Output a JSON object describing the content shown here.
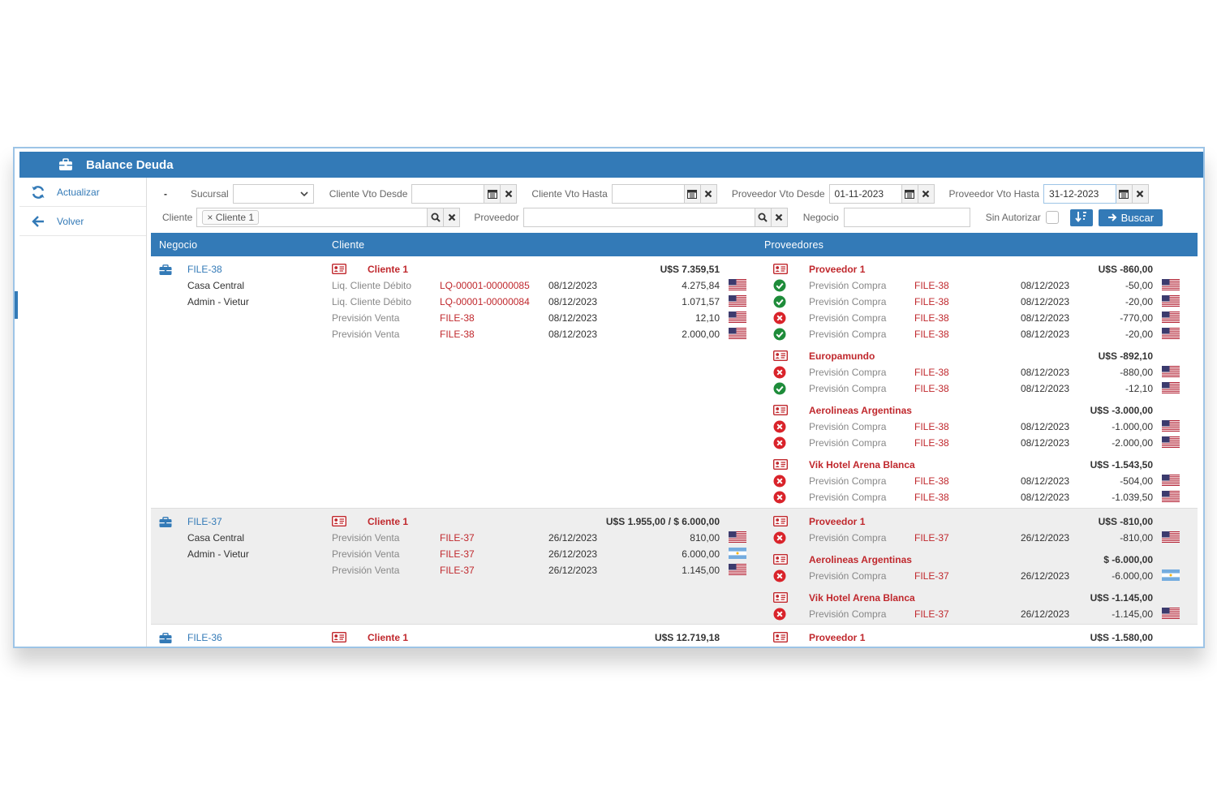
{
  "window": {
    "title": "Balance Deuda"
  },
  "sidebar": {
    "items": [
      {
        "label": "Actualizar",
        "icon": "refresh-icon"
      },
      {
        "label": "Volver",
        "icon": "arrow-left-icon"
      }
    ]
  },
  "filters": {
    "collapse": "-",
    "sucursal_label": "Sucursal",
    "cliente_vto_desde_label": "Cliente Vto Desde",
    "cliente_vto_hasta_label": "Cliente Vto Hasta",
    "proveedor_vto_desde_label": "Proveedor Vto Desde",
    "proveedor_vto_desde_value": "01-11-2023",
    "proveedor_vto_hasta_label": "Proveedor Vto Hasta",
    "proveedor_vto_hasta_value": "31-12-2023",
    "cliente_label": "Cliente",
    "cliente_tag": "× Cliente 1",
    "proveedor_label": "Proveedor",
    "negocio_label": "Negocio",
    "sin_autorizar_label": "Sin Autorizar",
    "buscar_label": "Buscar"
  },
  "table": {
    "headers": {
      "negocio": "Negocio",
      "cliente": "Cliente",
      "proveedores": "Proveedores"
    },
    "groups": [
      {
        "file": "FILE-38",
        "sucursal": "Casa Central",
        "admin": "Admin - Vietur",
        "cliente": {
          "name": "Cliente 1",
          "total": "U$S 7.359,51",
          "rows": [
            {
              "tipo": "Liq. Cliente Débito",
              "ref": "LQ-00001-00000085",
              "fecha": "08/12/2023",
              "importe": "4.275,84",
              "flag": "us"
            },
            {
              "tipo": "Liq. Cliente Débito",
              "ref": "LQ-00001-00000084",
              "fecha": "08/12/2023",
              "importe": "1.071,57",
              "flag": "us"
            },
            {
              "tipo": "Previsión Venta",
              "ref": "FILE-38",
              "fecha": "08/12/2023",
              "importe": "12,10",
              "flag": "us"
            },
            {
              "tipo": "Previsión Venta",
              "ref": "FILE-38",
              "fecha": "08/12/2023",
              "importe": "2.000,00",
              "flag": "us"
            }
          ]
        },
        "proveedores": [
          {
            "name": "Proveedor 1",
            "total": "U$S -860,00",
            "rows": [
              {
                "status": "ok",
                "tipo": "Previsión Compra",
                "ref": "FILE-38",
                "fecha": "08/12/2023",
                "importe": "-50,00",
                "flag": "us"
              },
              {
                "status": "ok",
                "tipo": "Previsión Compra",
                "ref": "FILE-38",
                "fecha": "08/12/2023",
                "importe": "-20,00",
                "flag": "us"
              },
              {
                "status": "x",
                "tipo": "Previsión Compra",
                "ref": "FILE-38",
                "fecha": "08/12/2023",
                "importe": "-770,00",
                "flag": "us"
              },
              {
                "status": "ok",
                "tipo": "Previsión Compra",
                "ref": "FILE-38",
                "fecha": "08/12/2023",
                "importe": "-20,00",
                "flag": "us"
              }
            ]
          },
          {
            "name": "Europamundo",
            "total": "U$S -892,10",
            "rows": [
              {
                "status": "x",
                "tipo": "Previsión Compra",
                "ref": "FILE-38",
                "fecha": "08/12/2023",
                "importe": "-880,00",
                "flag": "us"
              },
              {
                "status": "ok",
                "tipo": "Previsión Compra",
                "ref": "FILE-38",
                "fecha": "08/12/2023",
                "importe": "-12,10",
                "flag": "us"
              }
            ]
          },
          {
            "name": "Aerolineas Argentinas",
            "total": "U$S -3.000,00",
            "rows": [
              {
                "status": "x",
                "tipo": "Previsión Compra",
                "ref": "FILE-38",
                "fecha": "08/12/2023",
                "importe": "-1.000,00",
                "flag": "us"
              },
              {
                "status": "x",
                "tipo": "Previsión Compra",
                "ref": "FILE-38",
                "fecha": "08/12/2023",
                "importe": "-2.000,00",
                "flag": "us"
              }
            ]
          },
          {
            "name": "Vik Hotel Arena Blanca",
            "total": "U$S -1.543,50",
            "rows": [
              {
                "status": "x",
                "tipo": "Previsión Compra",
                "ref": "FILE-38",
                "fecha": "08/12/2023",
                "importe": "-504,00",
                "flag": "us"
              },
              {
                "status": "x",
                "tipo": "Previsión Compra",
                "ref": "FILE-38",
                "fecha": "08/12/2023",
                "importe": "-1.039,50",
                "flag": "us"
              }
            ]
          }
        ]
      },
      {
        "file": "FILE-37",
        "sucursal": "Casa Central",
        "admin": "Admin - Vietur",
        "cliente": {
          "name": "Cliente 1",
          "total": "U$S 1.955,00 / $ 6.000,00",
          "rows": [
            {
              "tipo": "Previsión Venta",
              "ref": "FILE-37",
              "fecha": "26/12/2023",
              "importe": "810,00",
              "flag": "us"
            },
            {
              "tipo": "Previsión Venta",
              "ref": "FILE-37",
              "fecha": "26/12/2023",
              "importe": "6.000,00",
              "flag": "ar"
            },
            {
              "tipo": "Previsión Venta",
              "ref": "FILE-37",
              "fecha": "26/12/2023",
              "importe": "1.145,00",
              "flag": "us"
            }
          ]
        },
        "proveedores": [
          {
            "name": "Proveedor 1",
            "total": "U$S -810,00",
            "rows": [
              {
                "status": "x",
                "tipo": "Previsión Compra",
                "ref": "FILE-37",
                "fecha": "26/12/2023",
                "importe": "-810,00",
                "flag": "us"
              }
            ]
          },
          {
            "name": "Aerolineas Argentinas",
            "total": "$ -6.000,00",
            "rows": [
              {
                "status": "x",
                "tipo": "Previsión Compra",
                "ref": "FILE-37",
                "fecha": "26/12/2023",
                "importe": "-6.000,00",
                "flag": "ar"
              }
            ]
          },
          {
            "name": "Vik Hotel Arena Blanca",
            "total": "U$S -1.145,00",
            "rows": [
              {
                "status": "x",
                "tipo": "Previsión Compra",
                "ref": "FILE-37",
                "fecha": "26/12/2023",
                "importe": "-1.145,00",
                "flag": "us"
              }
            ]
          }
        ]
      },
      {
        "file": "FILE-36",
        "sucursal": "",
        "admin": "",
        "cliente": {
          "name": "Cliente 1",
          "total": "U$S 12.719,18",
          "rows": []
        },
        "proveedores": [
          {
            "name": "Proveedor 1",
            "total": "U$S -1.580,00",
            "rows": []
          }
        ]
      }
    ]
  }
}
